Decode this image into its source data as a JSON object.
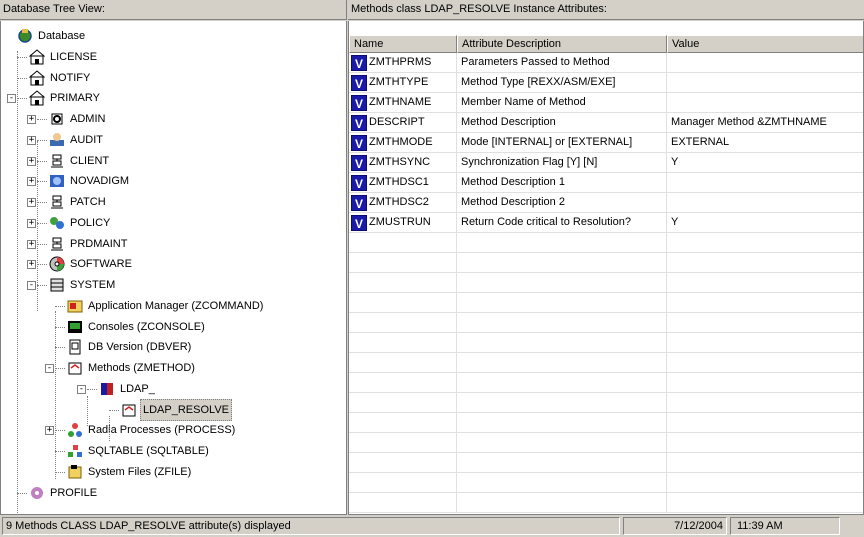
{
  "left_pane": {
    "title": "Database Tree View:"
  },
  "right_pane": {
    "title": "Methods class LDAP_RESOLVE Instance Attributes:"
  },
  "tree": {
    "root": {
      "label": "Database",
      "icon": "database-globe-icon"
    },
    "nodes": [
      {
        "label": "LICENSE",
        "icon": "domain-icon",
        "depth": 1,
        "expander": ""
      },
      {
        "label": "NOTIFY",
        "icon": "domain-icon",
        "depth": 1,
        "expander": ""
      },
      {
        "label": "PRIMARY",
        "icon": "domain-icon",
        "depth": 1,
        "expander": "-"
      },
      {
        "label": "ADMIN",
        "icon": "admin-icon",
        "depth": 2,
        "expander": "+"
      },
      {
        "label": "AUDIT",
        "icon": "audit-icon",
        "depth": 2,
        "expander": "+"
      },
      {
        "label": "CLIENT",
        "icon": "client-icon",
        "depth": 2,
        "expander": "+"
      },
      {
        "label": "NOVADIGM",
        "icon": "novadigm-icon",
        "depth": 2,
        "expander": "+"
      },
      {
        "label": "PATCH",
        "icon": "patch-icon",
        "depth": 2,
        "expander": "+"
      },
      {
        "label": "POLICY",
        "icon": "policy-icon",
        "depth": 2,
        "expander": "+"
      },
      {
        "label": "PRDMAINT",
        "icon": "prdmaint-icon",
        "depth": 2,
        "expander": "+"
      },
      {
        "label": "SOFTWARE",
        "icon": "software-icon",
        "depth": 2,
        "expander": "+"
      },
      {
        "label": "SYSTEM",
        "icon": "system-icon",
        "depth": 2,
        "expander": "-"
      },
      {
        "label": "Application Manager (ZCOMMAND)",
        "icon": "application-manager-icon",
        "depth": 3,
        "expander": ""
      },
      {
        "label": "Consoles (ZCONSOLE)",
        "icon": "console-icon",
        "depth": 3,
        "expander": ""
      },
      {
        "label": "DB Version (DBVER)",
        "icon": "db-version-icon",
        "depth": 3,
        "expander": ""
      },
      {
        "label": "Methods (ZMETHOD)",
        "icon": "methods-icon",
        "depth": 3,
        "expander": "-"
      },
      {
        "label": "LDAP_",
        "icon": "class-book-icon",
        "depth": 4,
        "expander": "-"
      },
      {
        "label": "LDAP_RESOLVE",
        "icon": "method-instance-icon",
        "depth": 5,
        "expander": "",
        "selected": true
      },
      {
        "label": "Radia Processes (PROCESS)",
        "icon": "process-icon",
        "depth": 3,
        "expander": "+"
      },
      {
        "label": "SQLTABLE (SQLTABLE)",
        "icon": "sqltable-icon",
        "depth": 3,
        "expander": ""
      },
      {
        "label": "System Files (ZFILE)",
        "icon": "system-files-icon",
        "depth": 3,
        "expander": ""
      },
      {
        "label": "PROFILE",
        "icon": "profile-icon",
        "depth": 1,
        "expander": ""
      }
    ]
  },
  "grid": {
    "columns": [
      "Name",
      "Attribute Description",
      "Value"
    ],
    "row_icon": "V",
    "rows": [
      {
        "name": "ZMTHPRMS",
        "desc": "Parameters Passed to Method",
        "value": ""
      },
      {
        "name": "ZMTHTYPE",
        "desc": "Method Type [REXX/ASM/EXE]",
        "value": ""
      },
      {
        "name": "ZMTHNAME",
        "desc": "Member Name of Method",
        "value": ""
      },
      {
        "name": "DESCRIPT",
        "desc": "Method Description",
        "value": "Manager Method &ZMTHNAME"
      },
      {
        "name": "ZMTHMODE",
        "desc": "Mode [INTERNAL] or [EXTERNAL]",
        "value": "EXTERNAL"
      },
      {
        "name": "ZMTHSYNC",
        "desc": "Synchronization Flag [Y] [N]",
        "value": "Y"
      },
      {
        "name": "ZMTHDSC1",
        "desc": "Method Description 1",
        "value": ""
      },
      {
        "name": "ZMTHDSC2",
        "desc": "Method Description 2",
        "value": ""
      },
      {
        "name": "ZMUSTRUN",
        "desc": "Return Code critical to Resolution?",
        "value": "Y"
      }
    ]
  },
  "status": {
    "message": "9 Methods CLASS LDAP_RESOLVE attribute(s) displayed",
    "date": "7/12/2004",
    "time": "11:39 AM"
  },
  "colors": {
    "chrome": "#d4d0c8",
    "v_icon": "#1a1aa8",
    "selection": "#d4d0c8"
  }
}
